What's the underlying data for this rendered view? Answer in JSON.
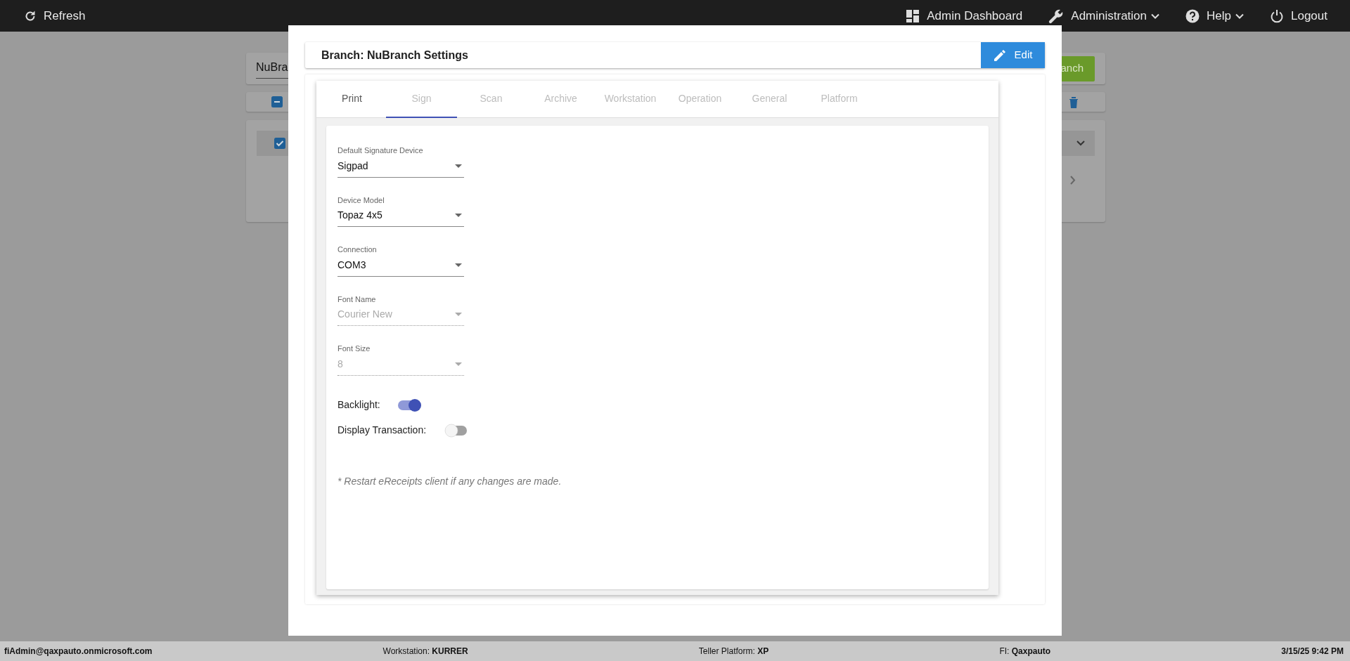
{
  "top_bar": {
    "left": [
      {
        "kind": "refresh",
        "label": "Refresh",
        "caret": false
      }
    ],
    "right": [
      {
        "kind": "dashboard",
        "label": "Admin Dashboard",
        "caret": false
      },
      {
        "kind": "wrench",
        "label": "Administration",
        "caret": true
      },
      {
        "kind": "help",
        "label": "Help",
        "caret": true
      },
      {
        "kind": "power",
        "label": "Logout",
        "caret": false
      }
    ]
  },
  "background": {
    "branch_field_value": "NuBra",
    "add_button_label": "anch",
    "bulk_checkbox": {
      "indeterminate": true
    },
    "row_checkbox": {
      "checked": true
    }
  },
  "header": {
    "title": "Branch: NuBranch Settings",
    "edit_button": "Edit"
  },
  "tabs": [
    {
      "label": "Print",
      "selected": false,
      "disabled": false
    },
    {
      "label": "Sign",
      "selected": true,
      "disabled": true
    },
    {
      "label": "Scan",
      "selected": false,
      "disabled": true
    },
    {
      "label": "Archive",
      "selected": false,
      "disabled": true
    },
    {
      "label": "Workstation",
      "selected": false,
      "disabled": true
    },
    {
      "label": "Operation",
      "selected": false,
      "disabled": true
    },
    {
      "label": "General",
      "selected": false,
      "disabled": true
    },
    {
      "label": "Platform",
      "selected": false,
      "disabled": true
    }
  ],
  "fields": [
    {
      "label": "Default Signature Device",
      "value": "Sigpad",
      "disabled": false
    },
    {
      "label": "Device Model",
      "value": "Topaz 4x5",
      "disabled": false
    },
    {
      "label": "Connection",
      "value": "COM3",
      "disabled": false
    },
    {
      "label": "Font Name",
      "value": "Courier New",
      "disabled": true
    },
    {
      "label": "Font Size",
      "value": "8",
      "disabled": true
    }
  ],
  "toggles": [
    {
      "label": "Backlight:",
      "on": true
    },
    {
      "label": "Display Transaction:",
      "on": false
    }
  ],
  "note": "* Restart eReceipts client if any changes are made.",
  "status_bar": [
    {
      "value": "fiAdmin@qaxpauto.onmicrosoft.com"
    },
    {
      "label": "Workstation:",
      "value": "KURRER"
    },
    {
      "label": "Teller Platform:",
      "value": "XP"
    },
    {
      "label": "FI:",
      "value": "Qaxpauto"
    },
    {
      "value": "3/15/25 9:42 PM"
    }
  ]
}
